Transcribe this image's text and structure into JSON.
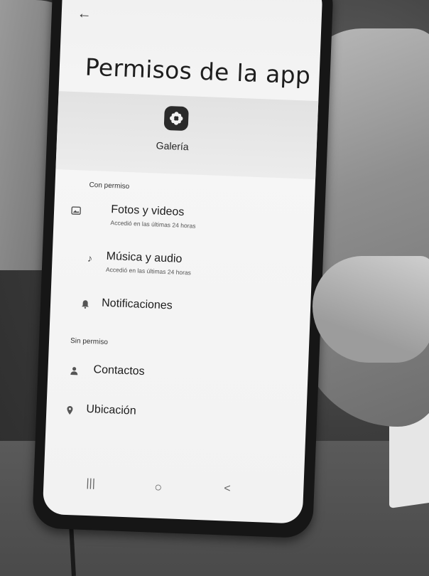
{
  "screen": {
    "title": "Permisos de la app",
    "back_icon": "back-arrow-icon"
  },
  "app": {
    "name": "Galería",
    "icon": "flower-icon"
  },
  "sections": {
    "allowed_label": "Con permiso",
    "denied_label": "Sin permiso"
  },
  "allowed_permissions": [
    {
      "label": "Fotos y videos",
      "subtitle": "Accedió en las últimas 24 horas",
      "icon": "photo-icon"
    },
    {
      "label": "Música y audio",
      "subtitle": "Accedió en las últimas 24 horas",
      "icon": "music-note-icon"
    },
    {
      "label": "Notificaciones",
      "subtitle": "",
      "icon": "bell-icon"
    }
  ],
  "denied_permissions": [
    {
      "label": "Contactos",
      "icon": "person-icon"
    },
    {
      "label": "Ubicación",
      "icon": "location-pin-icon"
    }
  ],
  "nav": {
    "recent": "|||",
    "home": "○",
    "back": "<"
  }
}
